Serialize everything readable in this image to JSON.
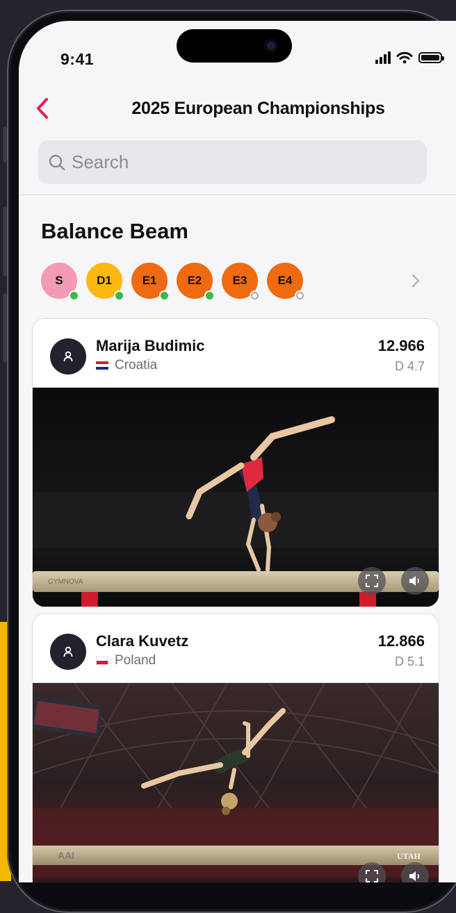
{
  "status_bar": {
    "time": "9:41"
  },
  "nav": {
    "title": "2025 European Championships"
  },
  "search": {
    "placeholder": "Search"
  },
  "section": {
    "title": "Balance Beam"
  },
  "judges": [
    {
      "label": "S",
      "color": "#f49ab2",
      "status": "online"
    },
    {
      "label": "D1",
      "color": "#fbb80f",
      "status": "online"
    },
    {
      "label": "E1",
      "color": "#ef6a10",
      "status": "online"
    },
    {
      "label": "E2",
      "color": "#ef6a10",
      "status": "online"
    },
    {
      "label": "E3",
      "color": "#ef6a10",
      "status": "offline"
    },
    {
      "label": "E4",
      "color": "#ef6a10",
      "status": "offline"
    }
  ],
  "athletes": [
    {
      "name": "Marija Budimic",
      "country": "Croatia",
      "flag": "croatia-flag-icon",
      "score": "12.966",
      "d_score": "D 4.7"
    },
    {
      "name": "Clara Kuvetz",
      "country": "Poland",
      "flag": "poland-flag-icon",
      "score": "12.866",
      "d_score": "D 5.1"
    }
  ],
  "colors": {
    "accent": "#e0234e",
    "avatar_bg": "#23222c",
    "highlight_band": "#f5b800"
  }
}
